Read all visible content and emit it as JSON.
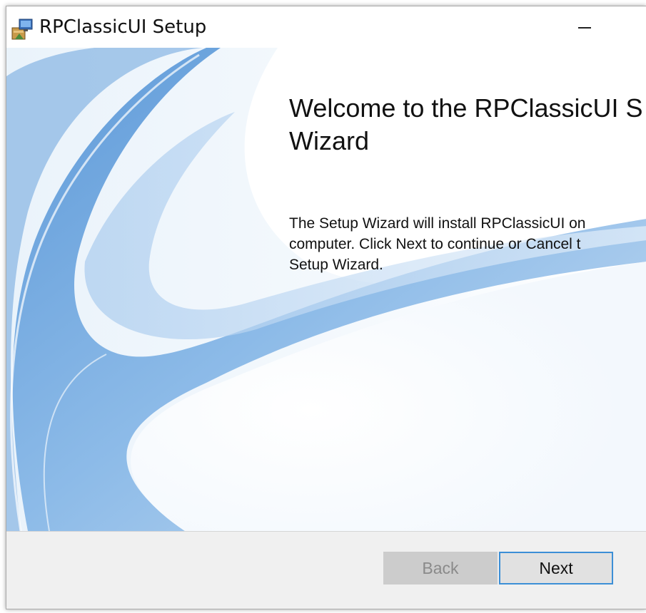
{
  "window": {
    "title": "RPClassicUI Setup",
    "minimize_label": "—"
  },
  "content": {
    "heading": "Welcome to the RPClassicUI S\nWizard",
    "body": "The Setup Wizard will install RPClassicUI on\ncomputer. Click Next to continue or Cancel t\nSetup Wizard."
  },
  "buttons": {
    "back_label": "Back",
    "next_label": "Next"
  },
  "colors": {
    "accent": "#3c8fd6",
    "footer_bg": "#f0f0f0",
    "disabled_button_bg": "#cccccc"
  },
  "icons": {
    "app": "installer-package-icon",
    "minimize": "minimize-icon"
  }
}
